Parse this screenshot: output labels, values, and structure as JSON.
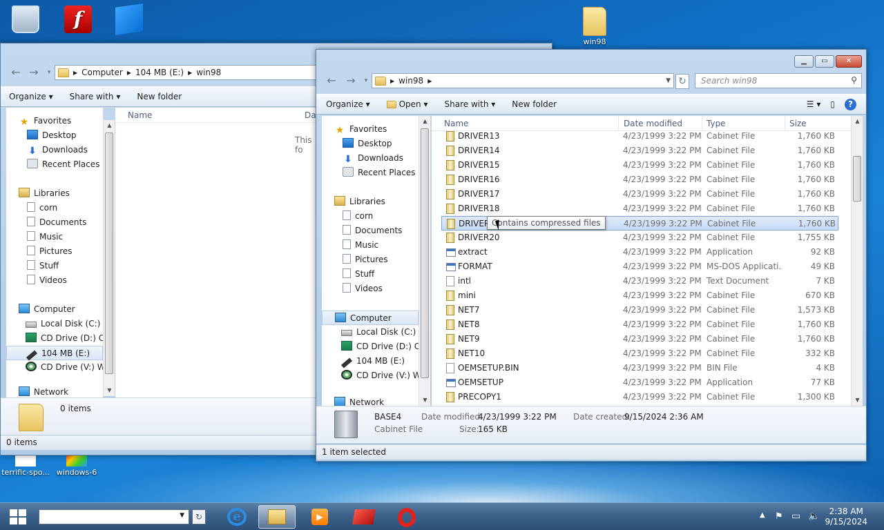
{
  "desktop": {
    "icons": [
      {
        "label": "win98"
      },
      {
        "label": "terrific-spo..."
      },
      {
        "label": "windows-6"
      }
    ]
  },
  "back_window": {
    "address": [
      "Computer",
      "104 MB (E:)",
      "win98"
    ],
    "toolbar": {
      "organize": "Organize",
      "share": "Share with",
      "new_folder": "New folder"
    },
    "column_name": "Name",
    "column_date_fragment": "Da",
    "empty_msg": "This fo",
    "nav": {
      "favorites": "Favorites",
      "desktop": "Desktop",
      "downloads": "Downloads",
      "recent": "Recent Places",
      "libraries": "Libraries",
      "corn": "corn",
      "documents": "Documents",
      "music": "Music",
      "pictures": "Pictures",
      "stuff": "Stuff",
      "videos": "Videos",
      "computer": "Computer",
      "local_disk": "Local Disk (C:)",
      "cd_d": "CD Drive (D:) CC",
      "usb": "104 MB (E:)",
      "cd_v": "CD Drive (V:) Wi",
      "network": "Network"
    },
    "items_count": "0 items",
    "status": "0 items"
  },
  "front_window": {
    "address": [
      "win98"
    ],
    "search_placeholder": "Search win98",
    "toolbar": {
      "organize": "Organize",
      "open": "Open",
      "share": "Share with",
      "new_folder": "New folder"
    },
    "columns": {
      "name": "Name",
      "date": "Date modified",
      "type": "Type",
      "size": "Size"
    },
    "nav": {
      "favorites": "Favorites",
      "desktop": "Desktop",
      "downloads": "Downloads",
      "recent": "Recent Places",
      "libraries": "Libraries",
      "corn": "corn",
      "documents": "Documents",
      "music": "Music",
      "pictures": "Pictures",
      "stuff": "Stuff",
      "videos": "Videos",
      "computer": "Computer",
      "local_disk": "Local Disk (C:)",
      "cd_d": "CD Drive (D:) CC",
      "usb": "104 MB (E:)",
      "cd_v": "CD Drive (V:) Wi",
      "network": "Network"
    },
    "files": [
      {
        "name": "DRIVER13",
        "date": "4/23/1999 3:22 PM",
        "type": "Cabinet File",
        "size": "1,760 KB",
        "icon": "cabinet-icon"
      },
      {
        "name": "DRIVER14",
        "date": "4/23/1999 3:22 PM",
        "type": "Cabinet File",
        "size": "1,760 KB",
        "icon": "cabinet-icon"
      },
      {
        "name": "DRIVER15",
        "date": "4/23/1999 3:22 PM",
        "type": "Cabinet File",
        "size": "1,760 KB",
        "icon": "cabinet-icon"
      },
      {
        "name": "DRIVER16",
        "date": "4/23/1999 3:22 PM",
        "type": "Cabinet File",
        "size": "1,760 KB",
        "icon": "cabinet-icon"
      },
      {
        "name": "DRIVER17",
        "date": "4/23/1999 3:22 PM",
        "type": "Cabinet File",
        "size": "1,760 KB",
        "icon": "cabinet-icon"
      },
      {
        "name": "DRIVER18",
        "date": "4/23/1999 3:22 PM",
        "type": "Cabinet File",
        "size": "1,760 KB",
        "icon": "cabinet-icon"
      },
      {
        "name": "DRIVER1",
        "date": "4/23/1999 3:22 PM",
        "type": "Cabinet File",
        "size": "1,760 KB",
        "icon": "cabinet-icon"
      },
      {
        "name": "DRIVER20",
        "date": "4/23/1999 3:22 PM",
        "type": "Cabinet File",
        "size": "1,755 KB",
        "icon": "cabinet-icon"
      },
      {
        "name": "extract",
        "date": "4/23/1999 3:22 PM",
        "type": "Application",
        "size": "92 KB",
        "icon": "application-icon"
      },
      {
        "name": "FORMAT",
        "date": "4/23/1999 3:22 PM",
        "type": "MS-DOS Applicati...",
        "size": "49 KB",
        "icon": "application-icon"
      },
      {
        "name": "intl",
        "date": "4/23/1999 3:22 PM",
        "type": "Text Document",
        "size": "7 KB",
        "icon": "text-document-icon"
      },
      {
        "name": "mini",
        "date": "4/23/1999 3:22 PM",
        "type": "Cabinet File",
        "size": "670 KB",
        "icon": "cabinet-icon"
      },
      {
        "name": "NET7",
        "date": "4/23/1999 3:22 PM",
        "type": "Cabinet File",
        "size": "1,573 KB",
        "icon": "cabinet-icon"
      },
      {
        "name": "NET8",
        "date": "4/23/1999 3:22 PM",
        "type": "Cabinet File",
        "size": "1,760 KB",
        "icon": "cabinet-icon"
      },
      {
        "name": "NET9",
        "date": "4/23/1999 3:22 PM",
        "type": "Cabinet File",
        "size": "1,760 KB",
        "icon": "cabinet-icon"
      },
      {
        "name": "NET10",
        "date": "4/23/1999 3:22 PM",
        "type": "Cabinet File",
        "size": "332 KB",
        "icon": "cabinet-icon"
      },
      {
        "name": "OEMSETUP.BIN",
        "date": "4/23/1999 3:22 PM",
        "type": "BIN File",
        "size": "4 KB",
        "icon": "bin-file-icon"
      },
      {
        "name": "OEMSETUP",
        "date": "4/23/1999 3:22 PM",
        "type": "Application",
        "size": "77 KB",
        "icon": "application-icon"
      },
      {
        "name": "PRECOPY1",
        "date": "4/23/1999 3:22 PM",
        "type": "Cabinet File",
        "size": "1,300 KB",
        "icon": "cabinet-icon"
      }
    ],
    "tooltip": "Contains compressed files",
    "details": {
      "name": "BASE4",
      "kind": "Cabinet File",
      "modified_label": "Date modified:",
      "modified": "4/23/1999 3:22 PM",
      "created_label": "Date created:",
      "created": "9/15/2024 2:36 AM",
      "size_label": "Size:",
      "size": "165 KB"
    },
    "status": "1 item selected"
  },
  "taskbar": {
    "clock_time": "2:38 AM",
    "clock_date": "9/15/2024"
  },
  "colors": {
    "accent": "#1c6cc4",
    "flash_red": "#cc1111",
    "opera_red": "#e0221b"
  }
}
